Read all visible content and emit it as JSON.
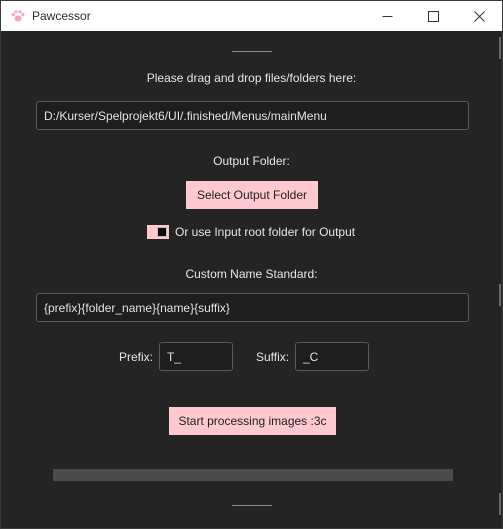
{
  "window": {
    "title": "Pawcessor",
    "icon": "paw-icon",
    "controls": [
      "minimize-icon",
      "maximize-icon",
      "close-icon"
    ]
  },
  "drop": {
    "prompt": "Please drag and drop files/folders here:",
    "path_value": "D:/Kurser/Spelprojekt6/UI/.finished/Menus/mainMenu"
  },
  "output": {
    "label": "Output Folder:",
    "select_button": "Select Output Folder",
    "checkbox_label": "Or use Input root folder for Output",
    "checkbox_checked": true
  },
  "naming": {
    "label": "Custom Name Standard:",
    "pattern_value": "{prefix}{folder_name}{name}{suffix}",
    "prefix_label": "Prefix:",
    "prefix_value": "T_",
    "suffix_label": "Suffix:",
    "suffix_value": "_C"
  },
  "actions": {
    "start_button": "Start processing images :3c"
  },
  "progress": {
    "value": 0
  },
  "colors": {
    "accent": "#ffc9cf",
    "background": "#242424",
    "titlebar": "#ffffff"
  }
}
